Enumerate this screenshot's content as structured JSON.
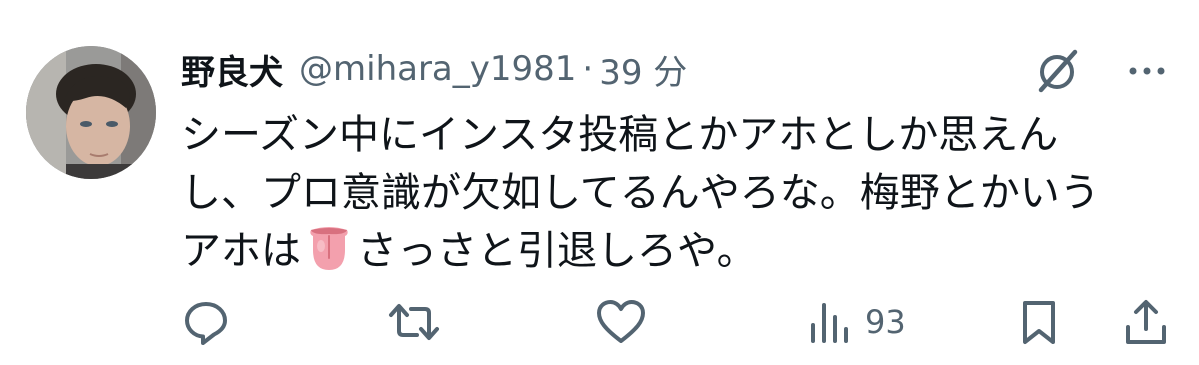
{
  "tweet": {
    "display_name": "野良犬",
    "handle": "@mihara_y1981",
    "separator": "·",
    "time": "39 分",
    "text_line1": "シーズン中にインスタ投稿とかアホとしか思えん",
    "text_line2": "し、プロ意識が欠如してるんやろな。梅野とかいう",
    "text_line3_before": "アホは",
    "text_line3_after": "さっさと引退しろや。",
    "emoji": "tongue-emoji",
    "views_count": "93"
  },
  "icons": {
    "grok": "grok-icon",
    "more": "more-dots-icon",
    "reply": "reply-icon",
    "retweet": "retweet-icon",
    "like": "heart-icon",
    "views": "views-icon",
    "bookmark": "bookmark-icon",
    "share": "share-icon"
  },
  "colors": {
    "text_primary": "#0f1419",
    "text_secondary": "#536471",
    "background": "#ffffff"
  }
}
